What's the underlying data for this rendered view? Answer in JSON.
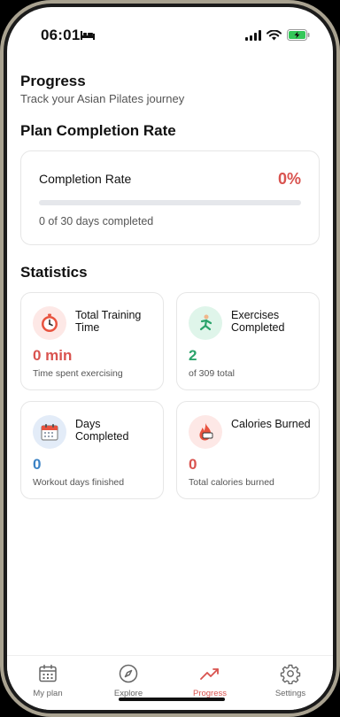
{
  "status_bar": {
    "time": "06:01"
  },
  "header": {
    "title": "Progress",
    "subtitle": "Track your Asian Pilates journey"
  },
  "plan": {
    "section_title": "Plan Completion Rate",
    "label": "Completion Rate",
    "percent": "0%",
    "progress_fraction": 0,
    "days_text": "0 of 30 days completed"
  },
  "statistics": {
    "section_title": "Statistics",
    "cards": [
      {
        "title": "Total Training Time",
        "value": "0 min",
        "desc": "Time spent exercising",
        "icon": "stopwatch-icon",
        "value_color": "#d9534f"
      },
      {
        "title": "Exercises Completed",
        "value": "2",
        "desc": "of 309 total",
        "icon": "pilates-figure-icon",
        "value_color": "#2aa36b"
      },
      {
        "title": "Days Completed",
        "value": "0",
        "desc": "Workout days finished",
        "icon": "calendar-icon",
        "value_color": "#3b82c4"
      },
      {
        "title": "Calories Burned",
        "value": "0",
        "desc": "Total calories burned",
        "icon": "flame-icon",
        "value_color": "#d9534f"
      }
    ]
  },
  "nav": {
    "items": [
      {
        "label": "My plan",
        "icon": "calendar-icon"
      },
      {
        "label": "Explore",
        "icon": "compass-icon"
      },
      {
        "label": "Progress",
        "icon": "trend-icon",
        "active": true
      },
      {
        "label": "Settings",
        "icon": "gear-icon"
      }
    ]
  },
  "colors": {
    "accent": "#d9534f",
    "green": "#2aa36b",
    "blue": "#3b82c4"
  }
}
